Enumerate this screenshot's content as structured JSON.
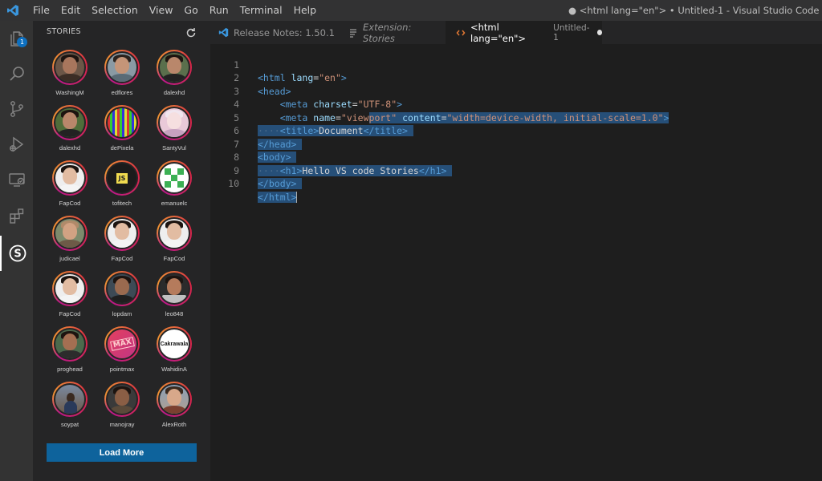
{
  "titlebar": {
    "menu": [
      "File",
      "Edit",
      "Selection",
      "View",
      "Go",
      "Run",
      "Terminal",
      "Help"
    ],
    "window_title": "● <html lang=\"en\"> • Untitled-1 - Visual Studio Code"
  },
  "activitybar": {
    "explorer_badge": "1",
    "items": [
      "explorer",
      "search",
      "source-control",
      "run-debug",
      "remote-explorer",
      "extensions",
      "stories"
    ]
  },
  "sidebar": {
    "title": "STORIES",
    "stories": [
      {
        "name": "WashingM"
      },
      {
        "name": "edflores"
      },
      {
        "name": "dalexhd"
      },
      {
        "name": "dalexhd"
      },
      {
        "name": "dePixela"
      },
      {
        "name": "SantyVul"
      },
      {
        "name": "FapCod"
      },
      {
        "name": "tofitech"
      },
      {
        "name": "emanuelc"
      },
      {
        "name": "judicael"
      },
      {
        "name": "FapCod"
      },
      {
        "name": "FapCod"
      },
      {
        "name": "FapCod"
      },
      {
        "name": "lopdam"
      },
      {
        "name": "leo848"
      },
      {
        "name": "proghead"
      },
      {
        "name": "pointmax"
      },
      {
        "name": "WahidinA"
      },
      {
        "name": "soypat"
      },
      {
        "name": "manojray"
      },
      {
        "name": "AlexRoth"
      }
    ],
    "load_more": "Load More",
    "avatar_texts": {
      "tofitech": "JS",
      "pointmax": "MAX",
      "WahidinA": "Cakrawala"
    }
  },
  "tabs": [
    {
      "label": "Release Notes: 1.50.1",
      "icon": "vscode-icon"
    },
    {
      "label": "Extension: Stories",
      "icon": "preview-icon"
    },
    {
      "label": "<html lang=\"en\">",
      "secondary": "Untitled-1",
      "icon": "html-icon",
      "dirty": true
    }
  ],
  "editor": {
    "line_numbers": [
      "1",
      "2",
      "3",
      "4",
      "5",
      "6",
      "7",
      "8",
      "9",
      "10"
    ]
  },
  "colors": {
    "accent": "#0e639c",
    "selection": "#264f78",
    "badge": "#0e70c0"
  }
}
